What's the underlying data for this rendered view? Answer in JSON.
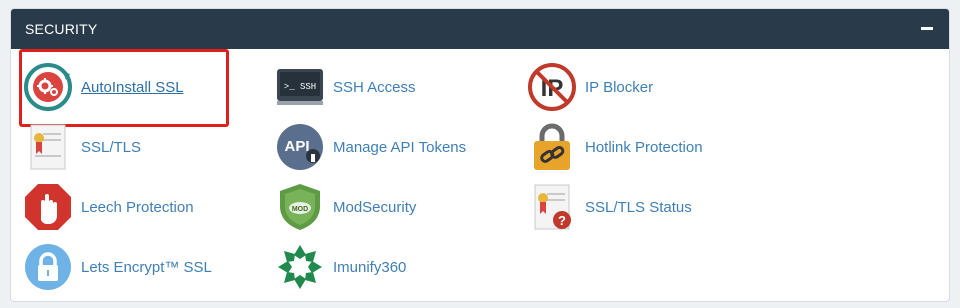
{
  "section": {
    "title": "SECURITY",
    "collapse_icon": "minus-icon"
  },
  "items": [
    {
      "id": "autoinstall-ssl",
      "label": "AutoInstall SSL",
      "icon": "autoinstall-ssl-icon"
    },
    {
      "id": "ssh-access",
      "label": "SSH Access",
      "icon": "terminal-icon",
      "icon_text": ">_ SSH"
    },
    {
      "id": "ip-blocker",
      "label": "IP Blocker",
      "icon": "ip-blocker-icon",
      "icon_text": "IP"
    },
    {
      "id": "ssl-tls",
      "label": "SSL/TLS",
      "icon": "certificate-icon"
    },
    {
      "id": "manage-api-tokens",
      "label": "Manage API Tokens",
      "icon": "api-key-icon",
      "icon_text": "API"
    },
    {
      "id": "hotlink-protection",
      "label": "Hotlink Protection",
      "icon": "padlock-chain-icon"
    },
    {
      "id": "leech-protection",
      "label": "Leech Protection",
      "icon": "stop-hand-icon"
    },
    {
      "id": "modsecurity",
      "label": "ModSecurity",
      "icon": "shield-icon",
      "icon_text": "MOD"
    },
    {
      "id": "ssl-tls-status",
      "label": "SSL/TLS Status",
      "icon": "certificate-question-icon",
      "icon_text": "?"
    },
    {
      "id": "lets-encrypt-ssl",
      "label": "Lets Encrypt™ SSL",
      "icon": "lock-circle-icon"
    },
    {
      "id": "imunify360",
      "label": "Imunify360",
      "icon": "imunify-icon"
    }
  ],
  "colors": {
    "header_bg": "#293a4a",
    "link": "#3f7fb6",
    "highlight": "#e0201b"
  },
  "state": {
    "highlighted_item": "AutoInstall SSL"
  }
}
